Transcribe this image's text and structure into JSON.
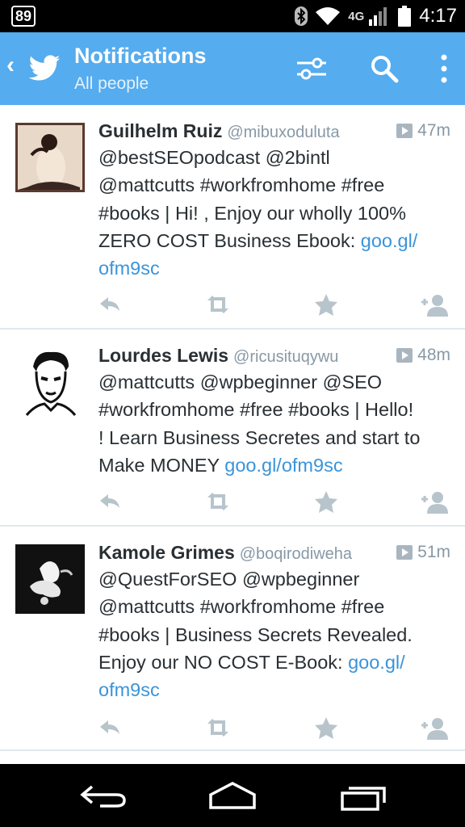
{
  "status_bar": {
    "notification_count": "89",
    "network": "4G",
    "time": "4:17"
  },
  "action_bar": {
    "title": "Notifications",
    "subtitle": "All people",
    "icons": [
      "back-chevron-icon",
      "twitter-bird-icon",
      "filter-icon",
      "search-icon",
      "more-vert-icon"
    ],
    "accent_color": "#55acee"
  },
  "tweets": [
    {
      "name": "Guilhelm Ruiz",
      "handle": "@mibuxoduluta",
      "time": "47m",
      "text_lines": [
        "@bestSEOpodcast @2bintl",
        "@mattcutts #workfromhome #free",
        "#books | Hi! , Enjoy our wholly 100%",
        "ZERO COST Business Ebook: "
      ],
      "link_parts": [
        "goo.gl/",
        "ofm9sc"
      ]
    },
    {
      "name": "Lourdes Lewis",
      "handle": "@ricusituqywu",
      "time": "48m",
      "text_lines": [
        "@mattcutts @wpbeginner @SEO",
        "#workfromhome #free #books | Hello!",
        "! Learn Business Secretes and start to",
        "Make MONEY "
      ],
      "link_parts": [
        "goo.gl/ofm9sc"
      ]
    },
    {
      "name": "Kamole Grimes",
      "handle": "@boqirodiweha",
      "time": "51m",
      "text_lines": [
        "@QuestForSEO @wpbeginner",
        "@mattcutts #workfromhome #free",
        "#books | Business Secrets Revealed.",
        "Enjoy our NO COST E-Book: "
      ],
      "link_parts": [
        "goo.gl/",
        "ofm9sc"
      ]
    }
  ],
  "tweet_actions": [
    "reply-icon",
    "retweet-icon",
    "favorite-icon",
    "follow-icon"
  ],
  "nav_bar": [
    "back-icon",
    "home-icon",
    "recents-icon"
  ]
}
